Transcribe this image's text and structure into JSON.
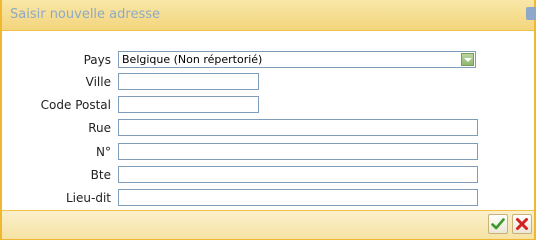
{
  "dialog": {
    "title": "Saisir nouvelle adresse"
  },
  "form": {
    "pays": {
      "label": "Pays",
      "value": "Belgique (Non répertorié)"
    },
    "ville": {
      "label": "Ville",
      "value": ""
    },
    "code_postal": {
      "label": "Code Postal",
      "value": ""
    },
    "rue": {
      "label": "Rue",
      "value": ""
    },
    "numero": {
      "label": "N°",
      "value": ""
    },
    "boite": {
      "label": "Bte",
      "value": ""
    },
    "lieu_dit": {
      "label": "Lieu-dit",
      "value": ""
    }
  },
  "buttons": {
    "ok_icon": "check-icon",
    "cancel_icon": "close-icon"
  },
  "colors": {
    "frame": "#f0b830",
    "title_text": "#8ea9c6",
    "ok": "#3a9a2a",
    "cancel": "#d42020"
  }
}
